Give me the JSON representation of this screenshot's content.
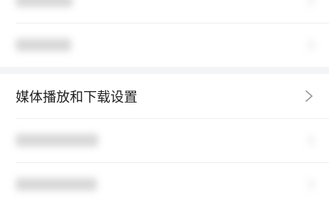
{
  "settings": {
    "visible_item": {
      "label": "媒体播放和下载设置",
      "icon": "chevron-right-icon"
    },
    "colors": {
      "background": "#f3f4f6",
      "card": "#ffffff",
      "text": "#1f1f1f",
      "chevron": "#9a9a9a"
    }
  }
}
